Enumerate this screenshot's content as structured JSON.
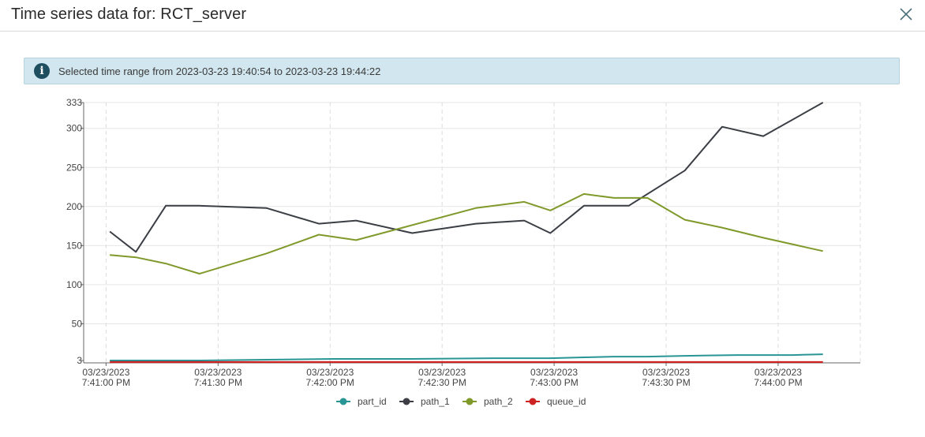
{
  "dialog": {
    "title": "Time series data for: RCT_server",
    "close_icon": "close-icon"
  },
  "info": {
    "icon": "info-icon",
    "text": "Selected time range from 2023-03-23 19:40:54 to 2023-03-23 19:44:22"
  },
  "chart_data": {
    "type": "line",
    "title": "",
    "xlabel": "",
    "ylabel": "",
    "xlim": [
      "2023-03-23 19:40:54",
      "2023-03-23 19:44:22"
    ],
    "ylim": [
      0,
      333
    ],
    "y_ticks": [
      3,
      50,
      100,
      150,
      200,
      250,
      300,
      333
    ],
    "x_ticks": [
      {
        "t": "2023-03-23 19:41:00",
        "date": "03/23/2023",
        "time": "7:41:00 PM"
      },
      {
        "t": "2023-03-23 19:41:30",
        "date": "03/23/2023",
        "time": "7:41:30 PM"
      },
      {
        "t": "2023-03-23 19:42:00",
        "date": "03/23/2023",
        "time": "7:42:00 PM"
      },
      {
        "t": "2023-03-23 19:42:30",
        "date": "03/23/2023",
        "time": "7:42:30 PM"
      },
      {
        "t": "2023-03-23 19:43:00",
        "date": "03/23/2023",
        "time": "7:43:00 PM"
      },
      {
        "t": "2023-03-23 19:43:30",
        "date": "03/23/2023",
        "time": "7:43:30 PM"
      },
      {
        "t": "2023-03-23 19:44:00",
        "date": "03/23/2023",
        "time": "7:44:00 PM"
      }
    ],
    "grid": true,
    "legend_position": "bottom",
    "series": [
      {
        "name": "part_id",
        "color": "#2a9595",
        "points": [
          [
            "2023-03-23 19:41:01",
            3
          ],
          [
            "2023-03-23 19:41:08",
            3
          ],
          [
            "2023-03-23 19:41:25",
            3
          ],
          [
            "2023-03-23 19:41:43",
            4
          ],
          [
            "2023-03-23 19:42:01",
            5
          ],
          [
            "2023-03-23 19:42:08",
            5
          ],
          [
            "2023-03-23 19:42:22",
            5
          ],
          [
            "2023-03-23 19:42:44",
            6
          ],
          [
            "2023-03-23 19:42:59",
            6
          ],
          [
            "2023-03-23 19:43:07",
            7
          ],
          [
            "2023-03-23 19:43:16",
            8
          ],
          [
            "2023-03-23 19:43:25",
            8
          ],
          [
            "2023-03-23 19:43:35",
            9
          ],
          [
            "2023-03-23 19:43:49",
            10
          ],
          [
            "2023-03-23 19:44:04",
            10
          ],
          [
            "2023-03-23 19:44:12",
            11
          ]
        ]
      },
      {
        "name": "path_1",
        "color": "#3b3f45",
        "points": [
          [
            "2023-03-23 19:41:01",
            168
          ],
          [
            "2023-03-23 19:41:08",
            142
          ],
          [
            "2023-03-23 19:41:16",
            201
          ],
          [
            "2023-03-23 19:41:25",
            201
          ],
          [
            "2023-03-23 19:41:43",
            198
          ],
          [
            "2023-03-23 19:41:57",
            178
          ],
          [
            "2023-03-23 19:42:07",
            182
          ],
          [
            "2023-03-23 19:42:22",
            166
          ],
          [
            "2023-03-23 19:42:39",
            178
          ],
          [
            "2023-03-23 19:42:52",
            182
          ],
          [
            "2023-03-23 19:42:59",
            166
          ],
          [
            "2023-03-23 19:43:08",
            201
          ],
          [
            "2023-03-23 19:43:20",
            201
          ],
          [
            "2023-03-23 19:43:35",
            246
          ],
          [
            "2023-03-23 19:43:45",
            302
          ],
          [
            "2023-03-23 19:43:56",
            290
          ],
          [
            "2023-03-23 19:44:12",
            333
          ]
        ]
      },
      {
        "name": "path_2",
        "color": "#7f9a2a",
        "points": [
          [
            "2023-03-23 19:41:01",
            138
          ],
          [
            "2023-03-23 19:41:08",
            135
          ],
          [
            "2023-03-23 19:41:16",
            127
          ],
          [
            "2023-03-23 19:41:25",
            114
          ],
          [
            "2023-03-23 19:41:43",
            140
          ],
          [
            "2023-03-23 19:41:57",
            164
          ],
          [
            "2023-03-23 19:42:07",
            157
          ],
          [
            "2023-03-23 19:42:39",
            198
          ],
          [
            "2023-03-23 19:42:52",
            206
          ],
          [
            "2023-03-23 19:42:59",
            195
          ],
          [
            "2023-03-23 19:43:08",
            216
          ],
          [
            "2023-03-23 19:43:16",
            211
          ],
          [
            "2023-03-23 19:43:25",
            211
          ],
          [
            "2023-03-23 19:43:35",
            183
          ],
          [
            "2023-03-23 19:43:45",
            173
          ],
          [
            "2023-03-23 19:43:56",
            160
          ],
          [
            "2023-03-23 19:44:12",
            143
          ]
        ]
      },
      {
        "name": "queue_id",
        "color": "#cc2222",
        "points": [
          [
            "2023-03-23 19:41:01",
            1
          ],
          [
            "2023-03-23 19:42:01",
            1
          ],
          [
            "2023-03-23 19:43:01",
            1
          ],
          [
            "2023-03-23 19:44:12",
            1
          ]
        ]
      }
    ]
  }
}
